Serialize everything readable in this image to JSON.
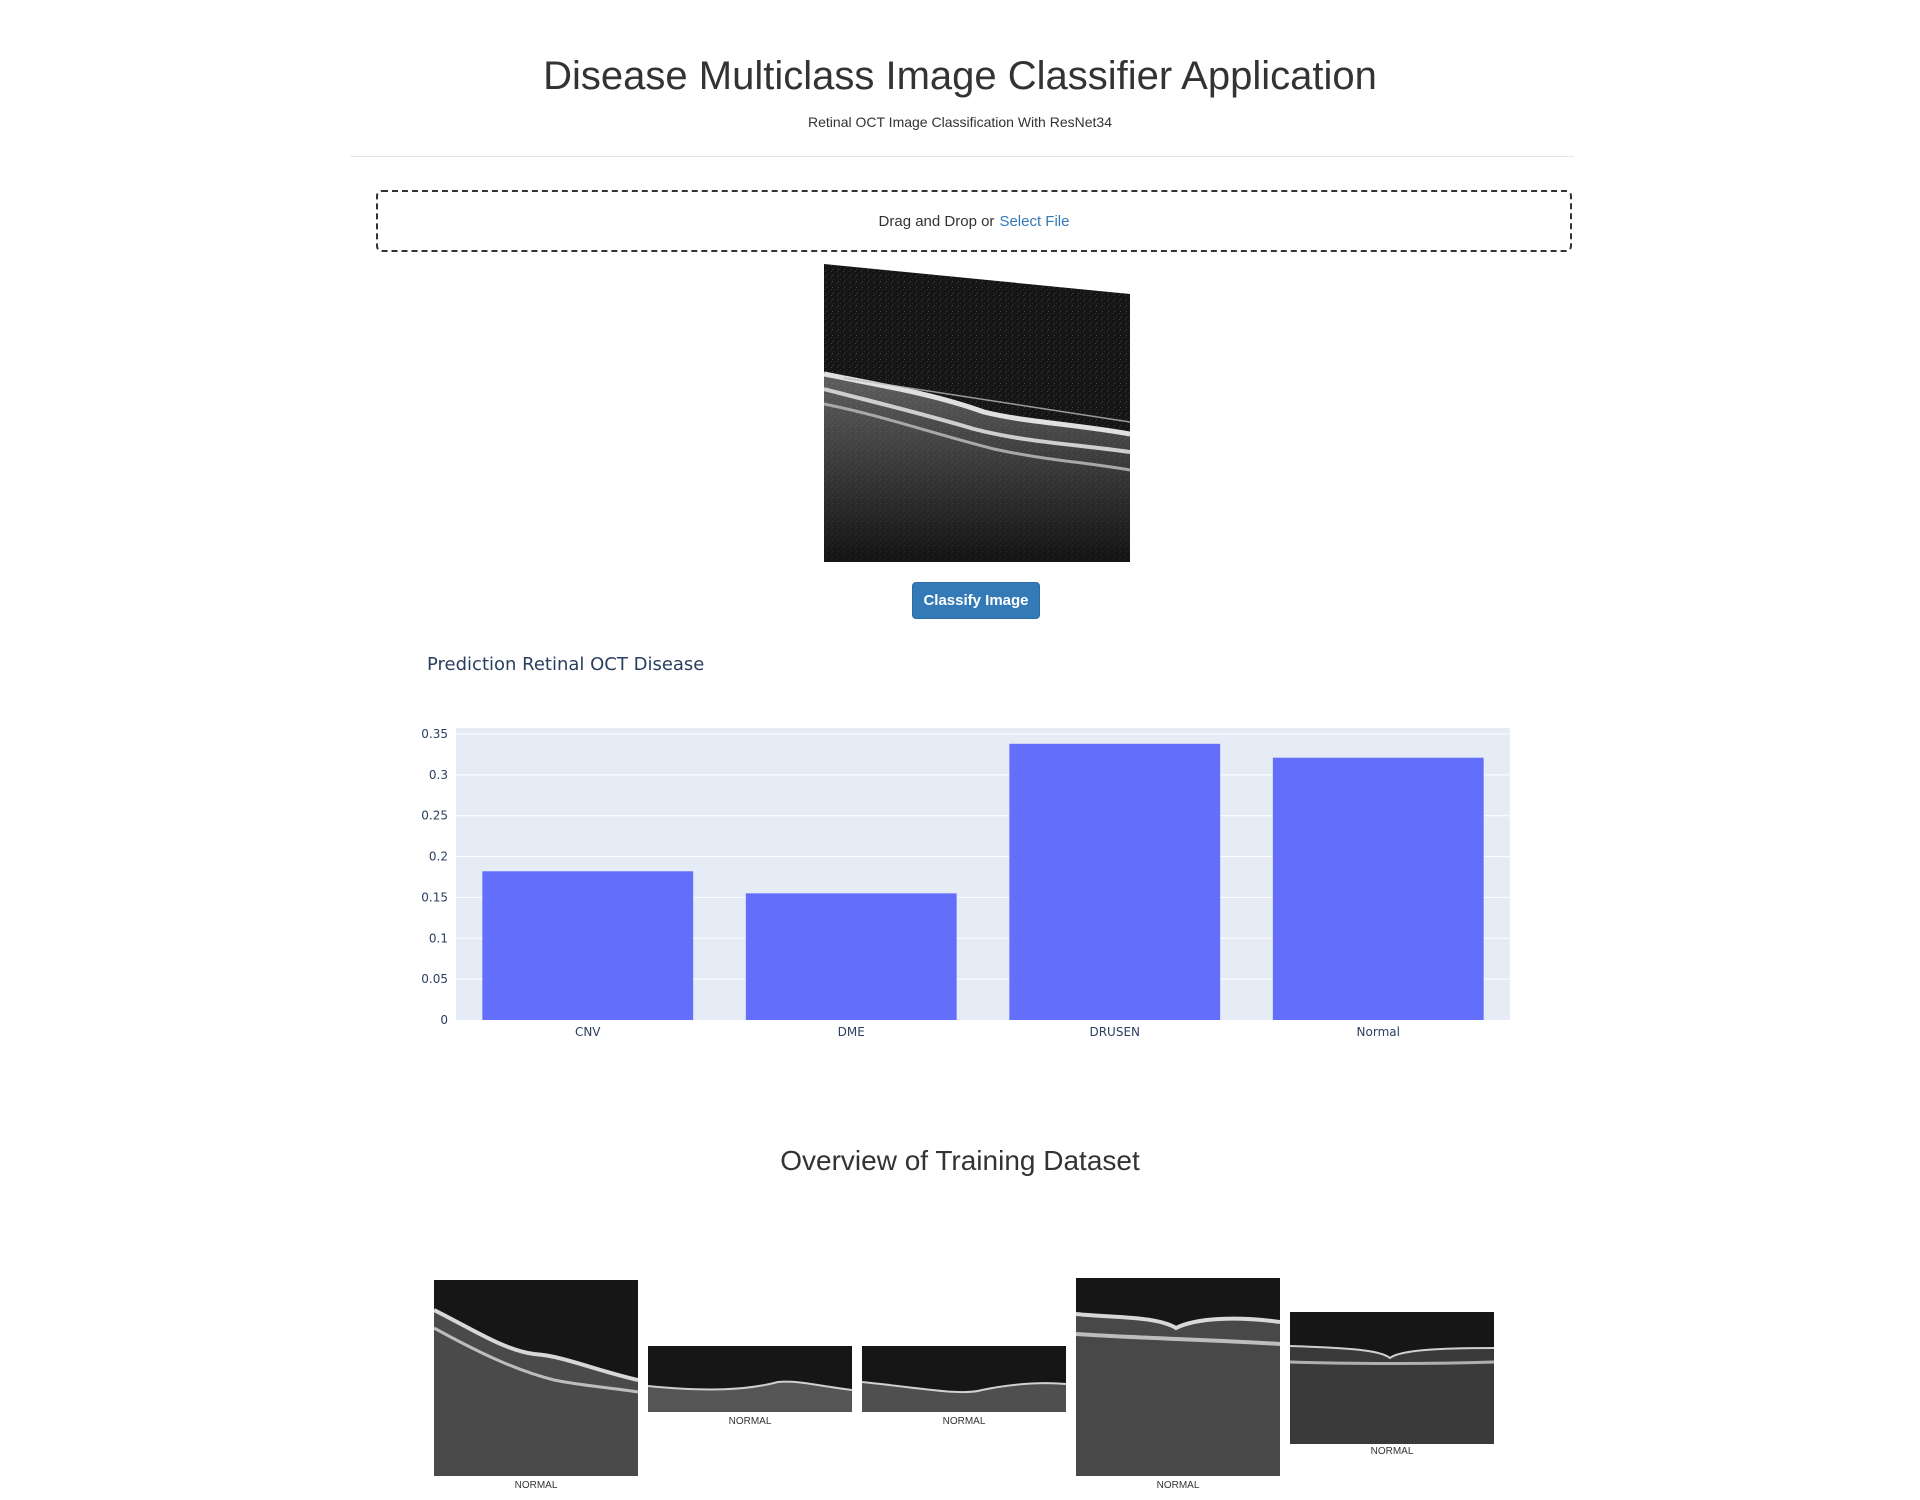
{
  "header": {
    "title": "Disease Multiclass Image Classifier Application",
    "subtitle": "Retinal OCT Image Classification With ResNet34"
  },
  "upload": {
    "prompt": "Drag and Drop or",
    "link_label": "Select File"
  },
  "classify_button": {
    "label": "Classify Image",
    "color": "#337ab7"
  },
  "prediction": {
    "title": "Prediction Retinal OCT Disease"
  },
  "chart_data": {
    "type": "bar",
    "categories": [
      "CNV",
      "DME",
      "DRUSEN",
      "Normal"
    ],
    "values": [
      0.182,
      0.155,
      0.338,
      0.321
    ],
    "ylim": [
      0,
      0.35
    ],
    "yticks": [
      "0",
      "0.05",
      "0.1",
      "0.15",
      "0.2",
      "0.25",
      "0.3",
      "0.35"
    ],
    "ytick_values": [
      0,
      0.05,
      0.1,
      0.15,
      0.2,
      0.25,
      0.3,
      0.35
    ],
    "bar_color": "#636efa",
    "plot_background": "#e5ecf6",
    "grid": true
  },
  "training": {
    "title": "Overview of Training Dataset",
    "samples": [
      {
        "label": "NORMAL"
      },
      {
        "label": "NORMAL"
      },
      {
        "label": "NORMAL"
      },
      {
        "label": "NORMAL"
      },
      {
        "label": "NORMAL"
      }
    ]
  }
}
